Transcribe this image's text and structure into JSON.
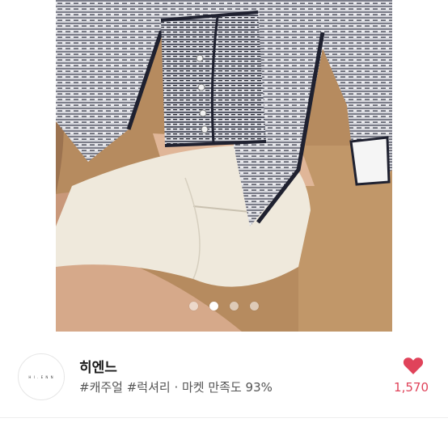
{
  "gallery": {
    "page_count": 4,
    "active_index": 1
  },
  "shop": {
    "logo_text": "H I . E N N",
    "name": "히엔느",
    "tags": "#캐주얼 #럭셔리 · 마켓 만족도 93%",
    "likes": "1,570",
    "heart_icon": "heart-icon",
    "heart_color": "#e0435a"
  }
}
